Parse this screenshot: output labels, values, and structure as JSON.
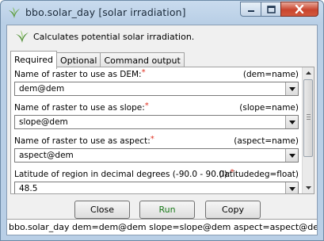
{
  "window": {
    "title": "bbo.solar_day [solar irradiation]"
  },
  "description": "Calculates potential solar irradiation.",
  "tabs": [
    {
      "label": "Required",
      "active": true
    },
    {
      "label": "Optional",
      "active": false
    },
    {
      "label": "Command output",
      "active": false
    }
  ],
  "fields": [
    {
      "label": "Name of raster to use as DEM:",
      "required": "*",
      "key": "(dem=name)",
      "value": "dem@dem"
    },
    {
      "label": "Name of raster to use as slope:",
      "required": "*",
      "key": "(slope=name)",
      "value": "slope@dem"
    },
    {
      "label": "Name of raster to use as aspect:",
      "required": "*",
      "key": "(aspect=name)",
      "value": "aspect@dem"
    },
    {
      "label": "Latitude of region in decimal degrees (-90.0 - 90.0):",
      "required": "*",
      "key": "(latitudedeg=float)",
      "value": "48.5"
    }
  ],
  "buttons": {
    "close": "Close",
    "run": "Run",
    "copy": "Copy"
  },
  "command_line": "bbo.solar_day dem=dem@dem slope=slope@dem aspect=aspect@dem",
  "colors": {
    "required_marker": "#e03020",
    "run_text": "#1a7a1a",
    "close_button": "#c9452e"
  },
  "icons": [
    "grass-logo-icon",
    "minimize-icon",
    "maximize-icon",
    "close-icon",
    "chevron-down-icon",
    "scroll-up-icon",
    "scroll-down-icon"
  ]
}
